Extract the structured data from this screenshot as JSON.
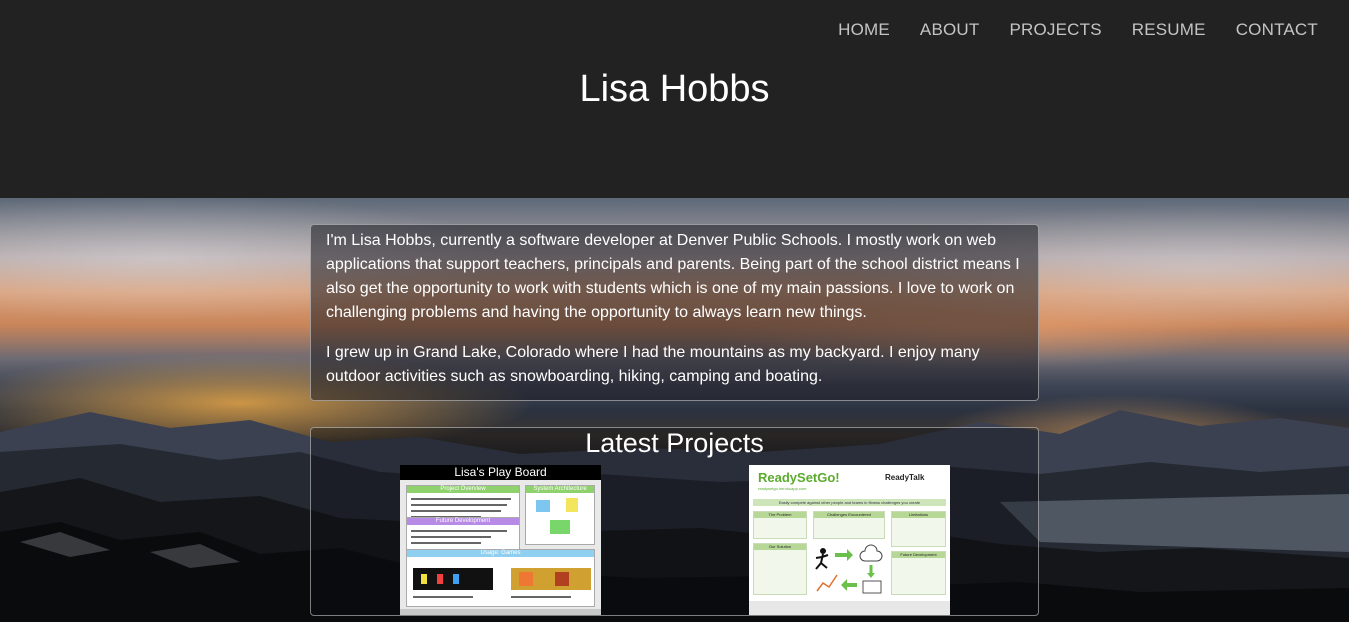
{
  "nav": {
    "items": [
      "HOME",
      "ABOUT",
      "PROJECTS",
      "RESUME",
      "CONTACT"
    ]
  },
  "header": {
    "title": "Lisa Hobbs"
  },
  "bio": {
    "paragraphs": [
      "I'm Lisa Hobbs, currently a software developer at Denver Public Schools. I mostly work on web applications that support teachers, principals and parents. Being part of the school district means I also get the opportunity to work with students which is one of my main passions. I love to work on challenging problems and having the opportunity to always learn new things.",
      "I grew up in Grand Lake, Colorado where I had the mountains as my backyard. I enjoy many outdoor activities such as snowboarding, hiking, camping and boating."
    ]
  },
  "projects": {
    "title": "Latest Projects",
    "items": [
      {
        "title": "Lisa's Play Board",
        "sections": [
          "Project Overview",
          "System Architecture",
          "Future Development",
          "Usage: Games",
          "Block Game",
          "Simon Game"
        ]
      },
      {
        "title": "ReadySetGo!",
        "brand": "ReadyTalk",
        "subtitle": "readysetgo.herokuapp.com",
        "tagline": "Easily compete against other people and teams in fitness challenges you create",
        "sections": [
          "The Problem",
          "Challenges Encountered",
          "Limitations",
          "Our Solution",
          "Future Development"
        ]
      }
    ]
  },
  "colors": {
    "header_bg": "#222222",
    "nav_text": "#c4c4c4",
    "accent_green": "#5bab2e"
  }
}
